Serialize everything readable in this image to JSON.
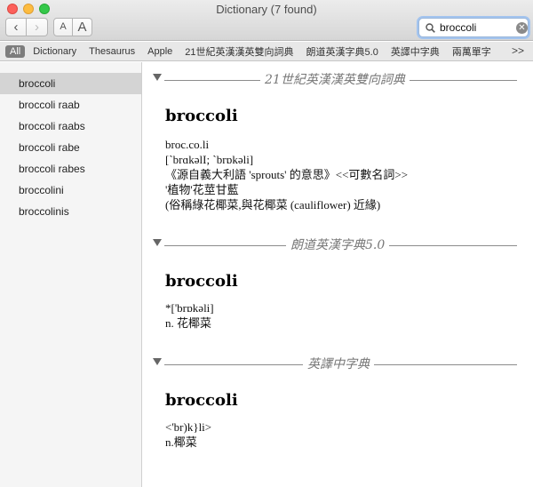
{
  "window": {
    "title": "Dictionary (7 found)"
  },
  "toolbar": {
    "back": "‹",
    "forward": "›",
    "font_smaller": "A",
    "font_larger": "A"
  },
  "search": {
    "value": "broccoli"
  },
  "sources": {
    "tabs": [
      "All",
      "Dictionary",
      "Thesaurus",
      "Apple",
      "21世紀英漢漢英雙向詞典",
      "朗道英漢字典5.0",
      "英譯中字典",
      "兩萬單字"
    ],
    "active": "All",
    "more": ">>"
  },
  "sidebar": {
    "items": [
      "broccoli",
      "broccoli raab",
      "broccoli raabs",
      "broccoli rabe",
      "broccoli rabes",
      "broccolini",
      "broccolinis"
    ],
    "selected": "broccoli"
  },
  "sections": [
    {
      "title": "21世紀英漢漢英雙向詞典",
      "headword": "broccoli",
      "lines": [
        "broc.co.li",
        "[`brɑkəlI; `brɒkəli]",
        "《源自義大利語 'sprouts' 的意思》<<可數名詞>>",
        "'植物'花莖甘藍",
        "(俗稱綠花椰菜,與花椰菜 (cauliflower) 近緣)"
      ]
    },
    {
      "title": "朗道英漢字典5.0",
      "headword": "broccoli",
      "lines": [
        "*['brɒkəli]",
        "n. 花椰菜"
      ]
    },
    {
      "title": "英譯中字典",
      "headword": "broccoli",
      "lines": [
        "<'br)k}li>",
        "n.椰菜"
      ]
    }
  ]
}
